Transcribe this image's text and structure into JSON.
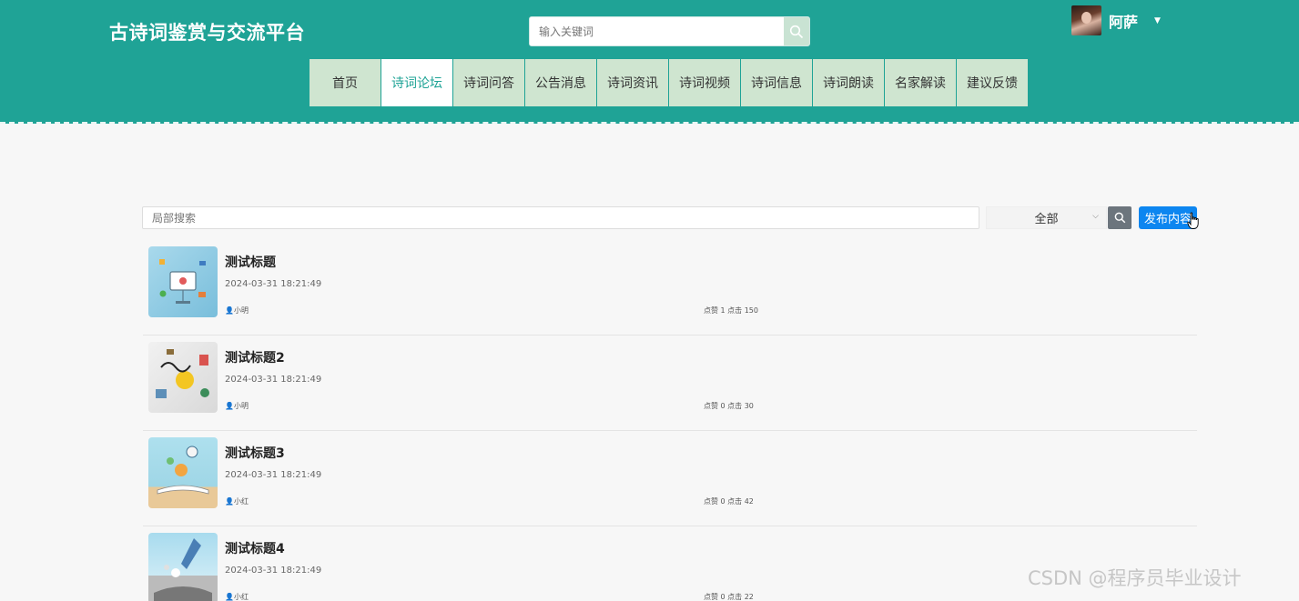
{
  "header": {
    "logo": "古诗词鉴赏与交流平台",
    "search_placeholder": "输入关键词",
    "user_name": "阿萨",
    "bg_color": "#1fa396"
  },
  "nav": [
    {
      "label": "首页",
      "active": false
    },
    {
      "label": "诗词论坛",
      "active": true
    },
    {
      "label": "诗词问答",
      "active": false
    },
    {
      "label": "公告消息",
      "active": false
    },
    {
      "label": "诗词资讯",
      "active": false
    },
    {
      "label": "诗词视频",
      "active": false
    },
    {
      "label": "诗词信息",
      "active": false
    },
    {
      "label": "诗词朗读",
      "active": false
    },
    {
      "label": "名家解读",
      "active": false
    },
    {
      "label": "建议反馈",
      "active": false
    }
  ],
  "toolbar": {
    "search_placeholder": "局部搜索",
    "select_value": "全部",
    "publish_label": "发布内容"
  },
  "posts": [
    {
      "title": "测试标题",
      "date": "2024-03-31 18:21:49",
      "author": "小明",
      "stats": "点赞 1 点击 150"
    },
    {
      "title": "测试标题2",
      "date": "2024-03-31 18:21:49",
      "author": "小明",
      "stats": "点赞 0 点击 30"
    },
    {
      "title": "测试标题3",
      "date": "2024-03-31 18:21:49",
      "author": "小红",
      "stats": "点赞 0 点击 42"
    },
    {
      "title": "测试标题4",
      "date": "2024-03-31 18:21:49",
      "author": "小红",
      "stats": "点赞 0 点击 22"
    }
  ],
  "watermark": "CSDN @程序员毕业设计"
}
